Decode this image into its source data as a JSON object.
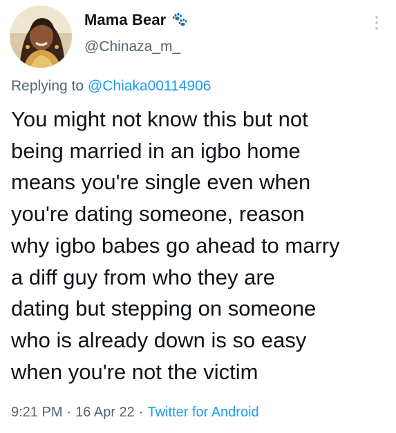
{
  "author": {
    "display_name": "Mama Bear",
    "badge_icon": "paw-prints-icon",
    "handle": "@Chinaza_m_"
  },
  "reply": {
    "prefix": "Replying to",
    "target": "@Chiaka00114906"
  },
  "tweet": {
    "text": "You might not know this but not\nbeing married in an igbo home\nmeans you're single even when\nyou're dating someone, reason\nwhy igbo babes go ahead to marry\na diff guy from who they are\ndating but stepping on someone\nwho is already down is so easy\nwhen you're not the victim"
  },
  "meta": {
    "time": "9:21 PM",
    "separator": "·",
    "date": "16 Apr 22",
    "source": "Twitter for Android"
  },
  "colors": {
    "link": "#1d9bf0",
    "secondary_text": "#536471",
    "primary_text": "#0f1419"
  }
}
